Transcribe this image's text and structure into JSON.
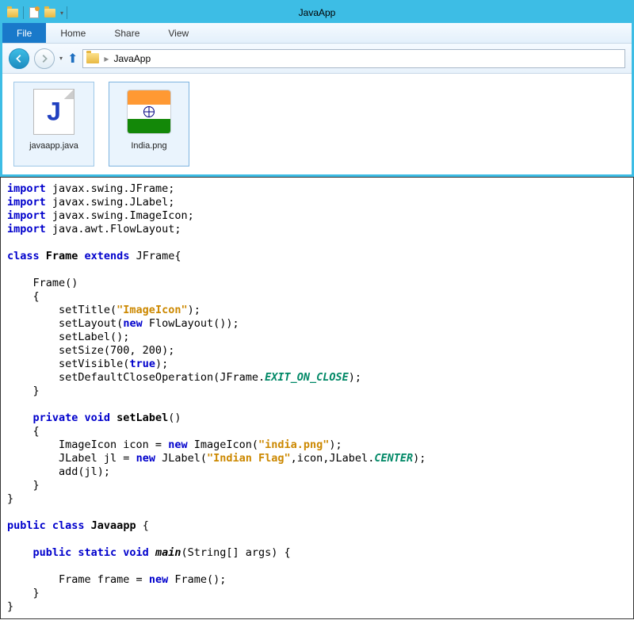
{
  "window": {
    "title": "JavaApp"
  },
  "ribbon": {
    "file": "File",
    "home": "Home",
    "share": "Share",
    "view": "View"
  },
  "address": {
    "sep": "▸",
    "folder": "JavaApp"
  },
  "files": {
    "item1": "javaapp.java",
    "item2": "India.png"
  },
  "code": {
    "l1a": "import",
    "l1b": " javax.swing.JFrame;",
    "l2a": "import",
    "l2b": " javax.swing.JLabel;",
    "l3a": "import",
    "l3b": " javax.swing.ImageIcon;",
    "l4a": "import",
    "l4b": " java.awt.FlowLayout;",
    "l6a": "class",
    "l6b": " Frame ",
    "l6c": "extends",
    "l6d": " JFrame{",
    "l8": "    Frame()",
    "l9": "    {",
    "l10a": "        setTitle(",
    "l10b": "\"ImageIcon\"",
    "l10c": ");",
    "l11a": "        setLayout(",
    "l11b": "new",
    "l11c": " FlowLayout());",
    "l12": "        setLabel();",
    "l13": "        setSize(700, 200);",
    "l14a": "        setVisible(",
    "l14b": "true",
    "l14c": ");",
    "l15a": "        setDefaultCloseOperation(JFrame.",
    "l15b": "EXIT_ON_CLOSE",
    "l15c": ");",
    "l16": "    }",
    "l18a": "    private void",
    "l18b": " setLabel",
    "l18c": "()",
    "l19": "    {",
    "l20a": "        ImageIcon icon = ",
    "l20b": "new",
    "l20c": " ImageIcon(",
    "l20d": "\"india.png\"",
    "l20e": ");",
    "l21a": "        JLabel jl = ",
    "l21b": "new",
    "l21c": " JLabel(",
    "l21d": "\"Indian Flag\"",
    "l21e": ",icon,JLabel.",
    "l21f": "CENTER",
    "l21g": ");",
    "l22": "        add(jl);",
    "l23": "    }",
    "l24": "}",
    "l26a": "public class",
    "l26b": " Javaapp ",
    "l26c": "{",
    "l28a": "    public static void ",
    "l28b": "main",
    "l28c": "(String[] args) {",
    "l30a": "        Frame frame = ",
    "l30b": "new",
    "l30c": " Frame();",
    "l31": "    }",
    "l32": "}"
  }
}
